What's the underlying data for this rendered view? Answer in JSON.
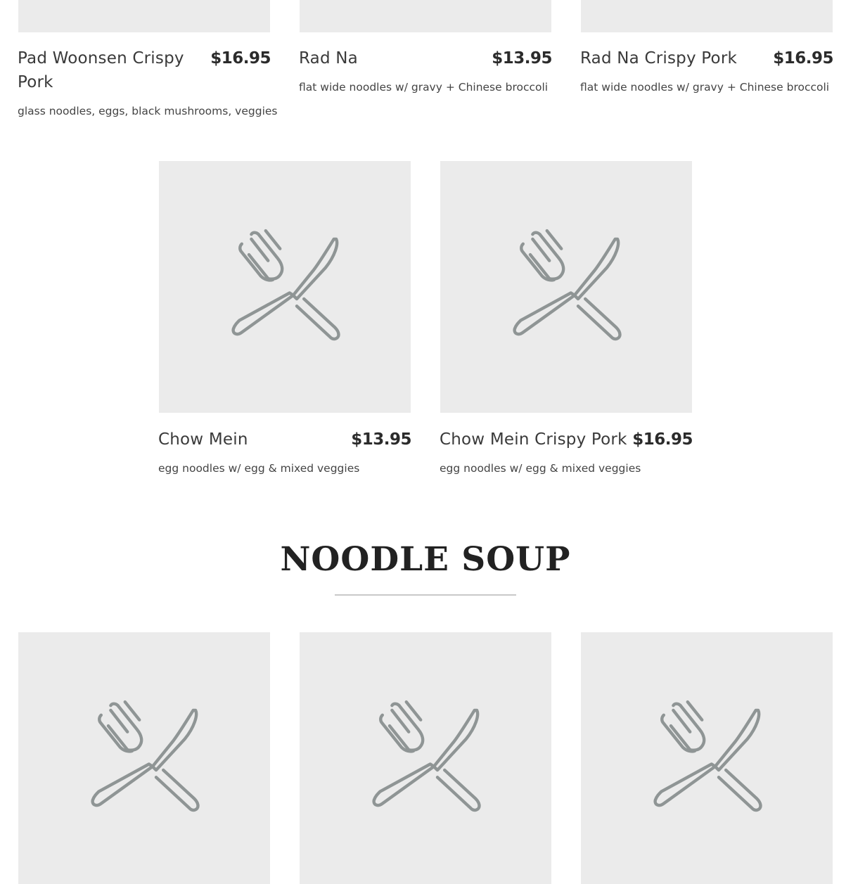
{
  "rows": [
    {
      "items": [
        {
          "name": "Pad Woonsen Crispy Pork",
          "price": "$16.95",
          "description": "glass noodles, eggs, black mushrooms, veggies",
          "image_icon": "fork-knife-icon"
        },
        {
          "name": "Rad Na",
          "price": "$13.95",
          "description": "flat wide noodles w/ gravy + Chinese broccoli",
          "image_icon": "fork-knife-icon"
        },
        {
          "name": "Rad Na Crispy Pork",
          "price": "$16.95",
          "description": "flat wide noodles w/ gravy + Chinese broccoli",
          "image_icon": "fork-knife-icon"
        }
      ]
    },
    {
      "items": [
        {
          "name": "Chow Mein",
          "price": "$13.95",
          "description": "egg noodles w/ egg & mixed veggies",
          "image_icon": "fork-knife-icon"
        },
        {
          "name": "Chow Mein Crispy Pork",
          "price": "$16.95",
          "description": "egg noodles w/ egg & mixed veggies",
          "image_icon": "fork-knife-icon"
        }
      ]
    }
  ],
  "section": {
    "title": "NOODLE SOUP",
    "items": [
      {
        "image_icon": "fork-knife-icon"
      },
      {
        "image_icon": "fork-knife-icon"
      },
      {
        "image_icon": "fork-knife-icon"
      }
    ]
  },
  "colors": {
    "placeholder_bg": "#ebebeb",
    "icon_stroke": "#8f9595",
    "rule": "#c9c9c9"
  }
}
